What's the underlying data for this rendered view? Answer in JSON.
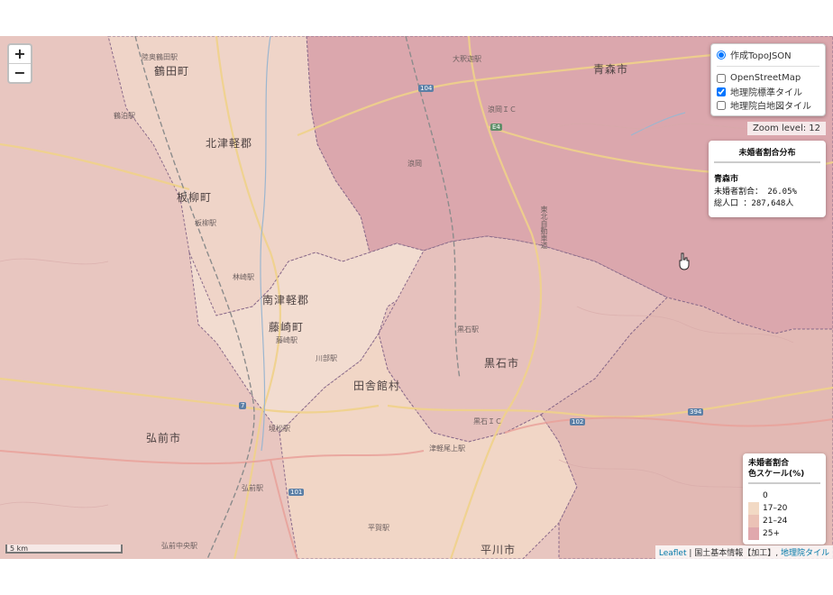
{
  "map": {
    "zoom_in": "+",
    "zoom_out": "−",
    "layers": {
      "topojson": "作成TopoJSON",
      "topojson_checked": true,
      "osm": "OpenStreetMap",
      "osm_checked": false,
      "gsi_std": "地理院標準タイル",
      "gsi_std_checked": true,
      "gsi_blank": "地理院白地図タイル",
      "gsi_blank_checked": false
    },
    "zoom_level": "Zoom level: 12",
    "info": {
      "title": "未婚者割合分布",
      "municipality": "青森市",
      "ratio_line": "未婚者割合：  26.05%",
      "pop_line": "総人口    ：287,648人"
    },
    "legend": {
      "title_line1": "未婚者割合",
      "title_line2": "色スケール(%)",
      "items": [
        {
          "label": "0",
          "color": "#ffffff"
        },
        {
          "label": "17–20",
          "color": "#f2d9c4"
        },
        {
          "label": "21–24",
          "color": "#ebc2b6"
        },
        {
          "label": "25+",
          "color": "#e0a8ad"
        }
      ]
    },
    "scale": "5 km",
    "attribution": {
      "leaflet": "Leaflet",
      "sep": " | 国土基本情報【加工】, ",
      "gsi": "地理院タイル"
    },
    "labels": {
      "aomori": "青森市",
      "kitatsugaru": "北津軽郡",
      "tsurutamachi": "鶴田町",
      "itayanagi": "板柳町",
      "minamitsugaru": "南津軽郡",
      "fujisaki": "藤崎町",
      "inakadate": "田舎館村",
      "kuroishi": "黒石市",
      "hirosaki": "弘前市",
      "hirakawa": "平川市",
      "namioka": "浪岡",
      "ozawa": "大釈迦駅",
      "namioka_ic": "浪岡ＩＣ",
      "kuroishi_ic": "黒石ＩＣ",
      "kuroishi_st": "黒石駅",
      "hirosaki_st": "弘前駅",
      "kawabe": "川部駅",
      "sakaimatsu": "境松駅",
      "tsugaru_onoe": "津軽尾上駅",
      "kitatokiwa": "北常盤駅",
      "hayashizaki": "林崎駅",
      "fujisaki_st": "藤崎駅",
      "itayanagi_st": "板柳駅",
      "tsurudomari": "鶴泊駅",
      "mutsutsuru": "陸奥鶴田駅",
      "hiranaka": "平賀駅",
      "hirosakichuo": "弘前中央駅",
      "higashi": "東北自動車道",
      "rt_101": "101",
      "rt_102": "102",
      "rt_7": "7",
      "rt_e4": "E4",
      "rt_394": "394",
      "rt_104": "104"
    }
  }
}
